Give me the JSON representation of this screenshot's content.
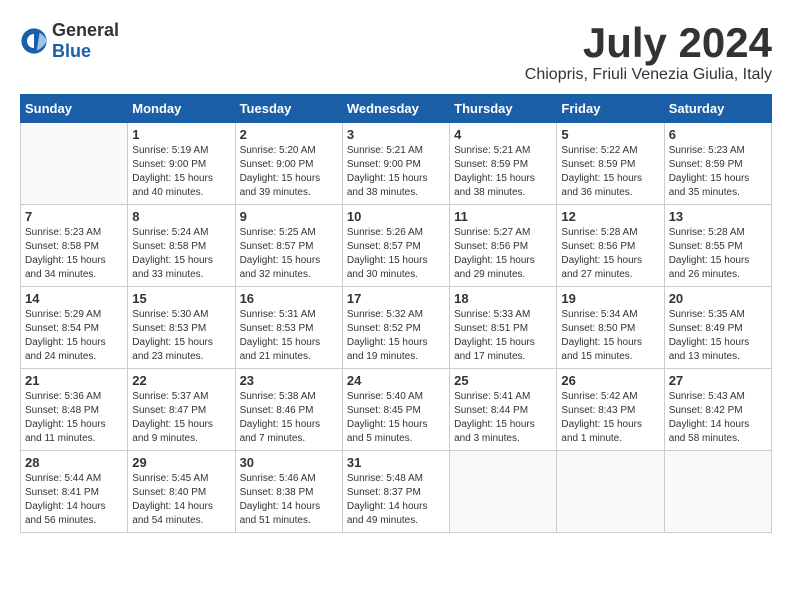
{
  "header": {
    "logo_general": "General",
    "logo_blue": "Blue",
    "title": "July 2024",
    "subtitle": "Chiopris, Friuli Venezia Giulia, Italy"
  },
  "calendar": {
    "days_of_week": [
      "Sunday",
      "Monday",
      "Tuesday",
      "Wednesday",
      "Thursday",
      "Friday",
      "Saturday"
    ],
    "weeks": [
      [
        {
          "day": "",
          "info": ""
        },
        {
          "day": "1",
          "info": "Sunrise: 5:19 AM\nSunset: 9:00 PM\nDaylight: 15 hours\nand 40 minutes."
        },
        {
          "day": "2",
          "info": "Sunrise: 5:20 AM\nSunset: 9:00 PM\nDaylight: 15 hours\nand 39 minutes."
        },
        {
          "day": "3",
          "info": "Sunrise: 5:21 AM\nSunset: 9:00 PM\nDaylight: 15 hours\nand 38 minutes."
        },
        {
          "day": "4",
          "info": "Sunrise: 5:21 AM\nSunset: 8:59 PM\nDaylight: 15 hours\nand 38 minutes."
        },
        {
          "day": "5",
          "info": "Sunrise: 5:22 AM\nSunset: 8:59 PM\nDaylight: 15 hours\nand 36 minutes."
        },
        {
          "day": "6",
          "info": "Sunrise: 5:23 AM\nSunset: 8:59 PM\nDaylight: 15 hours\nand 35 minutes."
        }
      ],
      [
        {
          "day": "7",
          "info": "Sunrise: 5:23 AM\nSunset: 8:58 PM\nDaylight: 15 hours\nand 34 minutes."
        },
        {
          "day": "8",
          "info": "Sunrise: 5:24 AM\nSunset: 8:58 PM\nDaylight: 15 hours\nand 33 minutes."
        },
        {
          "day": "9",
          "info": "Sunrise: 5:25 AM\nSunset: 8:57 PM\nDaylight: 15 hours\nand 32 minutes."
        },
        {
          "day": "10",
          "info": "Sunrise: 5:26 AM\nSunset: 8:57 PM\nDaylight: 15 hours\nand 30 minutes."
        },
        {
          "day": "11",
          "info": "Sunrise: 5:27 AM\nSunset: 8:56 PM\nDaylight: 15 hours\nand 29 minutes."
        },
        {
          "day": "12",
          "info": "Sunrise: 5:28 AM\nSunset: 8:56 PM\nDaylight: 15 hours\nand 27 minutes."
        },
        {
          "day": "13",
          "info": "Sunrise: 5:28 AM\nSunset: 8:55 PM\nDaylight: 15 hours\nand 26 minutes."
        }
      ],
      [
        {
          "day": "14",
          "info": "Sunrise: 5:29 AM\nSunset: 8:54 PM\nDaylight: 15 hours\nand 24 minutes."
        },
        {
          "day": "15",
          "info": "Sunrise: 5:30 AM\nSunset: 8:53 PM\nDaylight: 15 hours\nand 23 minutes."
        },
        {
          "day": "16",
          "info": "Sunrise: 5:31 AM\nSunset: 8:53 PM\nDaylight: 15 hours\nand 21 minutes."
        },
        {
          "day": "17",
          "info": "Sunrise: 5:32 AM\nSunset: 8:52 PM\nDaylight: 15 hours\nand 19 minutes."
        },
        {
          "day": "18",
          "info": "Sunrise: 5:33 AM\nSunset: 8:51 PM\nDaylight: 15 hours\nand 17 minutes."
        },
        {
          "day": "19",
          "info": "Sunrise: 5:34 AM\nSunset: 8:50 PM\nDaylight: 15 hours\nand 15 minutes."
        },
        {
          "day": "20",
          "info": "Sunrise: 5:35 AM\nSunset: 8:49 PM\nDaylight: 15 hours\nand 13 minutes."
        }
      ],
      [
        {
          "day": "21",
          "info": "Sunrise: 5:36 AM\nSunset: 8:48 PM\nDaylight: 15 hours\nand 11 minutes."
        },
        {
          "day": "22",
          "info": "Sunrise: 5:37 AM\nSunset: 8:47 PM\nDaylight: 15 hours\nand 9 minutes."
        },
        {
          "day": "23",
          "info": "Sunrise: 5:38 AM\nSunset: 8:46 PM\nDaylight: 15 hours\nand 7 minutes."
        },
        {
          "day": "24",
          "info": "Sunrise: 5:40 AM\nSunset: 8:45 PM\nDaylight: 15 hours\nand 5 minutes."
        },
        {
          "day": "25",
          "info": "Sunrise: 5:41 AM\nSunset: 8:44 PM\nDaylight: 15 hours\nand 3 minutes."
        },
        {
          "day": "26",
          "info": "Sunrise: 5:42 AM\nSunset: 8:43 PM\nDaylight: 15 hours\nand 1 minute."
        },
        {
          "day": "27",
          "info": "Sunrise: 5:43 AM\nSunset: 8:42 PM\nDaylight: 14 hours\nand 58 minutes."
        }
      ],
      [
        {
          "day": "28",
          "info": "Sunrise: 5:44 AM\nSunset: 8:41 PM\nDaylight: 14 hours\nand 56 minutes."
        },
        {
          "day": "29",
          "info": "Sunrise: 5:45 AM\nSunset: 8:40 PM\nDaylight: 14 hours\nand 54 minutes."
        },
        {
          "day": "30",
          "info": "Sunrise: 5:46 AM\nSunset: 8:38 PM\nDaylight: 14 hours\nand 51 minutes."
        },
        {
          "day": "31",
          "info": "Sunrise: 5:48 AM\nSunset: 8:37 PM\nDaylight: 14 hours\nand 49 minutes."
        },
        {
          "day": "",
          "info": ""
        },
        {
          "day": "",
          "info": ""
        },
        {
          "day": "",
          "info": ""
        }
      ]
    ]
  }
}
